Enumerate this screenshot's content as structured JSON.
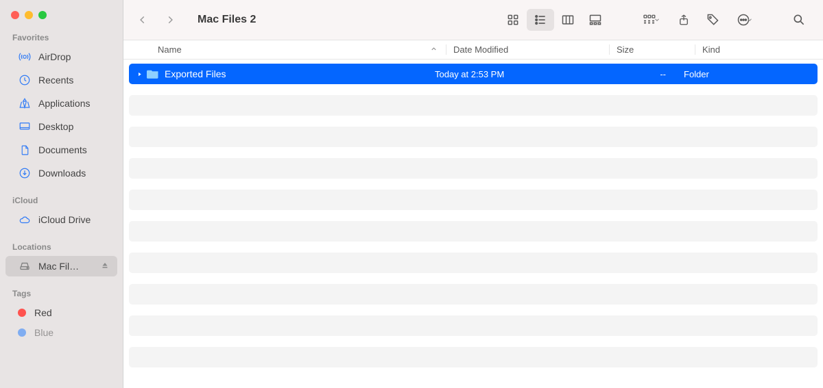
{
  "window_title": "Mac Files 2",
  "sidebar": {
    "sections": [
      {
        "title": "Favorites",
        "items": [
          {
            "icon": "airdrop",
            "label": "AirDrop"
          },
          {
            "icon": "clock",
            "label": "Recents"
          },
          {
            "icon": "apps",
            "label": "Applications"
          },
          {
            "icon": "desktop",
            "label": "Desktop"
          },
          {
            "icon": "doc",
            "label": "Documents"
          },
          {
            "icon": "download",
            "label": "Downloads"
          }
        ]
      },
      {
        "title": "iCloud",
        "items": [
          {
            "icon": "cloud",
            "label": "iCloud Drive"
          }
        ]
      },
      {
        "title": "Locations",
        "items": [
          {
            "icon": "drive",
            "label": "Mac Fil…",
            "active": true,
            "ejectable": true
          }
        ]
      },
      {
        "title": "Tags",
        "items": [
          {
            "icon": "tag",
            "label": "Red",
            "color": "#ff534f"
          },
          {
            "icon": "tag",
            "label": "Blue",
            "color": "#1b77ff",
            "partial": true
          }
        ]
      }
    ]
  },
  "columns": {
    "name": "Name",
    "date": "Date Modified",
    "size": "Size",
    "kind": "Kind"
  },
  "rows": [
    {
      "name": "Exported Files",
      "date": "Today at 2:53 PM",
      "size": "--",
      "kind": "Folder",
      "selected": true
    }
  ],
  "toolbar": {
    "views": [
      "icons",
      "list",
      "columns",
      "gallery"
    ],
    "active_view": "list"
  }
}
